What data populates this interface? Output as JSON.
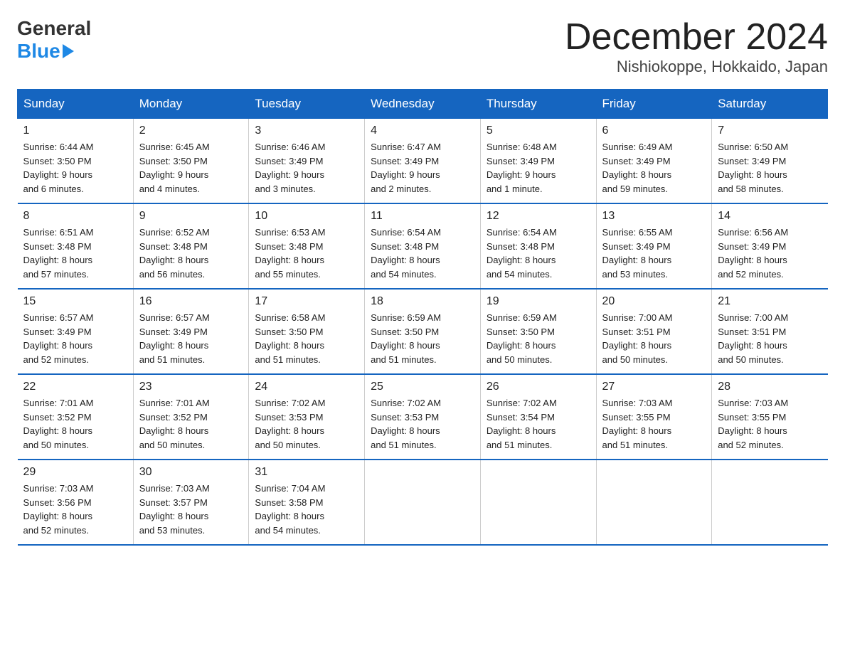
{
  "header": {
    "logo_general": "General",
    "logo_blue": "Blue",
    "title": "December 2024",
    "subtitle": "Nishiokoppe, Hokkaido, Japan"
  },
  "weekdays": [
    "Sunday",
    "Monday",
    "Tuesday",
    "Wednesday",
    "Thursday",
    "Friday",
    "Saturday"
  ],
  "weeks": [
    [
      {
        "num": "1",
        "sunrise": "6:44 AM",
        "sunset": "3:50 PM",
        "daylight": "9 hours and 6 minutes."
      },
      {
        "num": "2",
        "sunrise": "6:45 AM",
        "sunset": "3:50 PM",
        "daylight": "9 hours and 4 minutes."
      },
      {
        "num": "3",
        "sunrise": "6:46 AM",
        "sunset": "3:49 PM",
        "daylight": "9 hours and 3 minutes."
      },
      {
        "num": "4",
        "sunrise": "6:47 AM",
        "sunset": "3:49 PM",
        "daylight": "9 hours and 2 minutes."
      },
      {
        "num": "5",
        "sunrise": "6:48 AM",
        "sunset": "3:49 PM",
        "daylight": "9 hours and 1 minute."
      },
      {
        "num": "6",
        "sunrise": "6:49 AM",
        "sunset": "3:49 PM",
        "daylight": "8 hours and 59 minutes."
      },
      {
        "num": "7",
        "sunrise": "6:50 AM",
        "sunset": "3:49 PM",
        "daylight": "8 hours and 58 minutes."
      }
    ],
    [
      {
        "num": "8",
        "sunrise": "6:51 AM",
        "sunset": "3:48 PM",
        "daylight": "8 hours and 57 minutes."
      },
      {
        "num": "9",
        "sunrise": "6:52 AM",
        "sunset": "3:48 PM",
        "daylight": "8 hours and 56 minutes."
      },
      {
        "num": "10",
        "sunrise": "6:53 AM",
        "sunset": "3:48 PM",
        "daylight": "8 hours and 55 minutes."
      },
      {
        "num": "11",
        "sunrise": "6:54 AM",
        "sunset": "3:48 PM",
        "daylight": "8 hours and 54 minutes."
      },
      {
        "num": "12",
        "sunrise": "6:54 AM",
        "sunset": "3:48 PM",
        "daylight": "8 hours and 54 minutes."
      },
      {
        "num": "13",
        "sunrise": "6:55 AM",
        "sunset": "3:49 PM",
        "daylight": "8 hours and 53 minutes."
      },
      {
        "num": "14",
        "sunrise": "6:56 AM",
        "sunset": "3:49 PM",
        "daylight": "8 hours and 52 minutes."
      }
    ],
    [
      {
        "num": "15",
        "sunrise": "6:57 AM",
        "sunset": "3:49 PM",
        "daylight": "8 hours and 52 minutes."
      },
      {
        "num": "16",
        "sunrise": "6:57 AM",
        "sunset": "3:49 PM",
        "daylight": "8 hours and 51 minutes."
      },
      {
        "num": "17",
        "sunrise": "6:58 AM",
        "sunset": "3:50 PM",
        "daylight": "8 hours and 51 minutes."
      },
      {
        "num": "18",
        "sunrise": "6:59 AM",
        "sunset": "3:50 PM",
        "daylight": "8 hours and 51 minutes."
      },
      {
        "num": "19",
        "sunrise": "6:59 AM",
        "sunset": "3:50 PM",
        "daylight": "8 hours and 50 minutes."
      },
      {
        "num": "20",
        "sunrise": "7:00 AM",
        "sunset": "3:51 PM",
        "daylight": "8 hours and 50 minutes."
      },
      {
        "num": "21",
        "sunrise": "7:00 AM",
        "sunset": "3:51 PM",
        "daylight": "8 hours and 50 minutes."
      }
    ],
    [
      {
        "num": "22",
        "sunrise": "7:01 AM",
        "sunset": "3:52 PM",
        "daylight": "8 hours and 50 minutes."
      },
      {
        "num": "23",
        "sunrise": "7:01 AM",
        "sunset": "3:52 PM",
        "daylight": "8 hours and 50 minutes."
      },
      {
        "num": "24",
        "sunrise": "7:02 AM",
        "sunset": "3:53 PM",
        "daylight": "8 hours and 50 minutes."
      },
      {
        "num": "25",
        "sunrise": "7:02 AM",
        "sunset": "3:53 PM",
        "daylight": "8 hours and 51 minutes."
      },
      {
        "num": "26",
        "sunrise": "7:02 AM",
        "sunset": "3:54 PM",
        "daylight": "8 hours and 51 minutes."
      },
      {
        "num": "27",
        "sunrise": "7:03 AM",
        "sunset": "3:55 PM",
        "daylight": "8 hours and 51 minutes."
      },
      {
        "num": "28",
        "sunrise": "7:03 AM",
        "sunset": "3:55 PM",
        "daylight": "8 hours and 52 minutes."
      }
    ],
    [
      {
        "num": "29",
        "sunrise": "7:03 AM",
        "sunset": "3:56 PM",
        "daylight": "8 hours and 52 minutes."
      },
      {
        "num": "30",
        "sunrise": "7:03 AM",
        "sunset": "3:57 PM",
        "daylight": "8 hours and 53 minutes."
      },
      {
        "num": "31",
        "sunrise": "7:04 AM",
        "sunset": "3:58 PM",
        "daylight": "8 hours and 54 minutes."
      },
      null,
      null,
      null,
      null
    ]
  ],
  "labels": {
    "sunrise": "Sunrise:",
    "sunset": "Sunset:",
    "daylight": "Daylight:"
  }
}
